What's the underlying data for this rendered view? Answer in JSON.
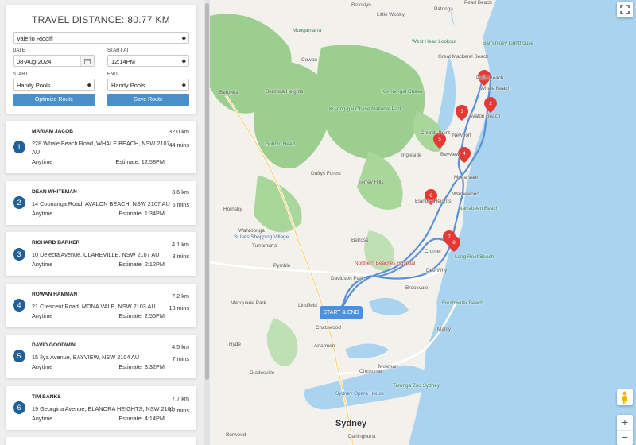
{
  "panel": {
    "title": "TRAVEL DISTANCE: 80.77 KM",
    "driver": "Valerio Ridolfi",
    "date_label": "DATE",
    "date_value": "08-Aug-2024",
    "start_at_label": "START AT",
    "start_at_value": "12:14PM",
    "start_label": "START",
    "start_value": "Handy Pools",
    "end_label": "END",
    "end_value": "Handy Pools",
    "optimize_label": "Optimize Route",
    "save_label": "Save Route"
  },
  "stops": [
    {
      "num": "1",
      "name": "MARIAM JACOB",
      "address": "228 Whale Beach Road, WHALE BEACH, NSW 2107",
      "address2": "AU",
      "window": "Anytime",
      "estimate": "Estimate: 12:58PM",
      "distance": "32.0 km",
      "duration": "44 mins"
    },
    {
      "num": "2",
      "name": "DEAN WHITEMAN",
      "address": "14 Coonanga Road, AVALON BEACH, NSW 2107 AU",
      "address2": "",
      "window": "Anytime",
      "estimate": "Estimate: 1:34PM",
      "distance": "3.6 km",
      "duration": "6 mins"
    },
    {
      "num": "3",
      "name": "RICHARD BARKER",
      "address": "10 Delecta Avenue, CLAREVILLE, NSW 2107 AU",
      "address2": "",
      "window": "Anytime",
      "estimate": "Estimate: 2:12PM",
      "distance": "4.1 km",
      "duration": "8 mins"
    },
    {
      "num": "4",
      "name": "ROWAN HAMMAN",
      "address": "21 Crescent Road, MONA VALE, NSW 2103 AU",
      "address2": "",
      "window": "Anytime",
      "estimate": "Estimate: 2:55PM",
      "distance": "7.2 km",
      "duration": "13 mins"
    },
    {
      "num": "5",
      "name": "DAVID GOODWIN",
      "address": "15 Ilya Avenue, BAYVIEW, NSW 2104 AU",
      "address2": "",
      "window": "Anytime",
      "estimate": "Estimate: 3:32PM",
      "distance": "4.5 km",
      "duration": "7 mins"
    },
    {
      "num": "6",
      "name": "TIM BANKS",
      "address": "19 Georgina Avenue, ELANORA HEIGHTS, NSW 2101",
      "address2": "",
      "window": "Anytime",
      "estimate": "Estimate: 4:14PM",
      "distance": "7.7 km",
      "duration": "12 mins"
    }
  ],
  "map": {
    "start_end_label": "START & END",
    "labels": {
      "brooklyn": "Brooklyn",
      "little_wobby": "Little Wobby",
      "patonga": "Patonga",
      "pearl_beach": "Pearl Beach",
      "muogamarra": "Muogamarra",
      "cowan": "Cowan",
      "westhead": "West Head Lookout",
      "barrenjoey": "Barrenjoey Lighthouse",
      "bobbin_head": "Bobbin Head",
      "berowra_heights": "Berowra Heights",
      "berowra": "Berowra",
      "kuringgai_park": "Ku-ring-gai Chase",
      "kuringgai_np": "Ku-ring-gai Chase National Park",
      "great_mackerel": "Great Mackerel Beach",
      "palm_beach": "Palm Beach",
      "whale_beach": "Whale Beach",
      "avalon": "Avalon Beach",
      "church_point": "Church Point",
      "newport": "Newport",
      "bayview": "Bayview",
      "mona_vale": "Mona Vale",
      "warriewood": "Warriewood",
      "narrabeen": "Narrabeen Beach",
      "ingleside": "Ingleside",
      "elanora": "Elanora Heights",
      "terrey_hills": "Terrey Hills",
      "duffys_forest": "Duffys Forest",
      "hornsby": "Hornsby",
      "wahroonga": "Wahroonga",
      "st_ives": "St Ives Shopping Village",
      "turramurra": "Turramurra",
      "belrose": "Belrose",
      "cromer": "Cromer",
      "dee_why": "Dee Why",
      "long_reef": "Long Reef Beach",
      "northern_beaches": "Northern Beaches Hospital",
      "davidson": "Davidson Park",
      "pymble": "Pymble",
      "macquarie": "Macquarie Park",
      "lindfield": "Lindfield",
      "chatswood": "Chatswood",
      "brookvale": "Brookvale",
      "freshwater": "Freshwater Beach",
      "manly": "Manly",
      "artarmon": "Artarmon",
      "mosman": "Mosman",
      "cremorne": "Cremorne",
      "ryde": "Ryde",
      "gladesville": "Gladesville",
      "sydney": "Sydney",
      "darlinghurst": "Darlinghurst",
      "burwood": "Burwood",
      "taronga": "Taronga Zoo Sydney",
      "sydney_opera": "Sydney Opera House"
    },
    "pins": [
      "1",
      "2",
      "3",
      "4",
      "5",
      "6",
      "7",
      "8"
    ]
  },
  "colors": {
    "button": "#4a8fca",
    "badge": "#1f5f9b",
    "route": "#5b8fd6",
    "pin": "#e53935",
    "water": "#aad3f0",
    "park": "#9ccf8f"
  }
}
